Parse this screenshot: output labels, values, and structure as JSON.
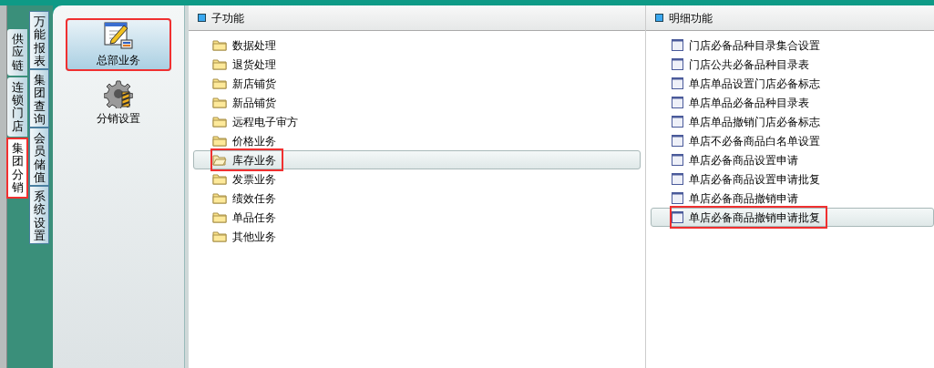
{
  "outer_tabs": [
    {
      "label": "供应链",
      "selected": false,
      "highlighted": false
    },
    {
      "label": "连锁门店",
      "selected": false,
      "highlighted": false
    },
    {
      "label": "集团分销",
      "selected": true,
      "highlighted": true
    }
  ],
  "inner_tabs": [
    {
      "label": "万能报表",
      "selected": false
    },
    {
      "label": "集团查询",
      "selected": false
    },
    {
      "label": "会员储值",
      "selected": false
    },
    {
      "label": "系统设置",
      "selected": false
    }
  ],
  "modules": [
    {
      "label": "总部业务",
      "kind": "notepad",
      "selected": true,
      "highlighted": true
    },
    {
      "label": "分销设置",
      "kind": "gear",
      "selected": false,
      "highlighted": false
    }
  ],
  "sub_functions": {
    "title": "子功能",
    "items": [
      {
        "label": "数据处理",
        "selected": false,
        "highlighted": false
      },
      {
        "label": "退货处理",
        "selected": false,
        "highlighted": false
      },
      {
        "label": "新店铺货",
        "selected": false,
        "highlighted": false
      },
      {
        "label": "新品铺货",
        "selected": false,
        "highlighted": false
      },
      {
        "label": "远程电子审方",
        "selected": false,
        "highlighted": false
      },
      {
        "label": "价格业务",
        "selected": false,
        "highlighted": false
      },
      {
        "label": "库存业务",
        "selected": true,
        "highlighted": true
      },
      {
        "label": "发票业务",
        "selected": false,
        "highlighted": false
      },
      {
        "label": "绩效任务",
        "selected": false,
        "highlighted": false
      },
      {
        "label": "单品任务",
        "selected": false,
        "highlighted": false
      },
      {
        "label": "其他业务",
        "selected": false,
        "highlighted": false
      }
    ]
  },
  "detail_functions": {
    "title": "明细功能",
    "items": [
      {
        "label": "门店必备品种目录集合设置",
        "selected": false,
        "highlighted": false
      },
      {
        "label": "门店公共必备品种目录表",
        "selected": false,
        "highlighted": false
      },
      {
        "label": "单店单品设置门店必备标志",
        "selected": false,
        "highlighted": false
      },
      {
        "label": "单店单品必备品种目录表",
        "selected": false,
        "highlighted": false
      },
      {
        "label": "单店单品撤销门店必备标志",
        "selected": false,
        "highlighted": false
      },
      {
        "label": "单店不必备商品白名单设置",
        "selected": false,
        "highlighted": false
      },
      {
        "label": "单店必备商品设置申请",
        "selected": false,
        "highlighted": false
      },
      {
        "label": "单店必备商品设置申请批复",
        "selected": false,
        "highlighted": false
      },
      {
        "label": "单店必备商品撤销申请",
        "selected": false,
        "highlighted": false
      },
      {
        "label": "单店必备商品撤销申请批复",
        "selected": true,
        "highlighted": true
      }
    ]
  }
}
